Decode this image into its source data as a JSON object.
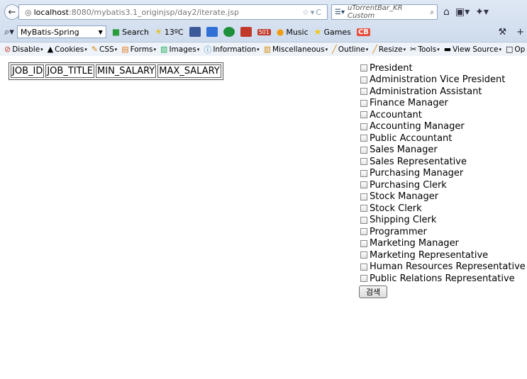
{
  "browser": {
    "url_host": "localhost",
    "url_rest": ":8080/mybatis3.1_originjsp/day2/iterate.jsp",
    "search_placeholder": "uTorrentBar_KR Custom"
  },
  "toolbar": {
    "search_combo": "MyBatis-Spring",
    "search_label": "Search",
    "weather": "13ºC",
    "badge_501": "501",
    "music_label": "Music",
    "games_label": "Games",
    "cb_label": "CB"
  },
  "dev_toolbar": {
    "items": [
      "Disable",
      "Cookies",
      "CSS",
      "Forms",
      "Images",
      "Information",
      "Miscellaneous",
      "Outline",
      "Resize",
      "Tools",
      "View Source",
      "Op"
    ]
  },
  "table": {
    "headers": [
      "JOB_ID",
      "JOB_TITLE",
      "MIN_SALARY",
      "MAX_SALARY"
    ]
  },
  "jobs": [
    "President",
    "Administration Vice President",
    "Administration Assistant",
    "Finance Manager",
    "Accountant",
    "Accounting Manager",
    "Public Accountant",
    "Sales Manager",
    "Sales Representative",
    "Purchasing Manager",
    "Purchasing Clerk",
    "Stock Manager",
    "Stock Clerk",
    "Shipping Clerk",
    "Programmer",
    "Marketing Manager",
    "Marketing Representative",
    "Human Resources Representative",
    "Public Relations Representative"
  ],
  "form": {
    "submit_label": "검색"
  }
}
